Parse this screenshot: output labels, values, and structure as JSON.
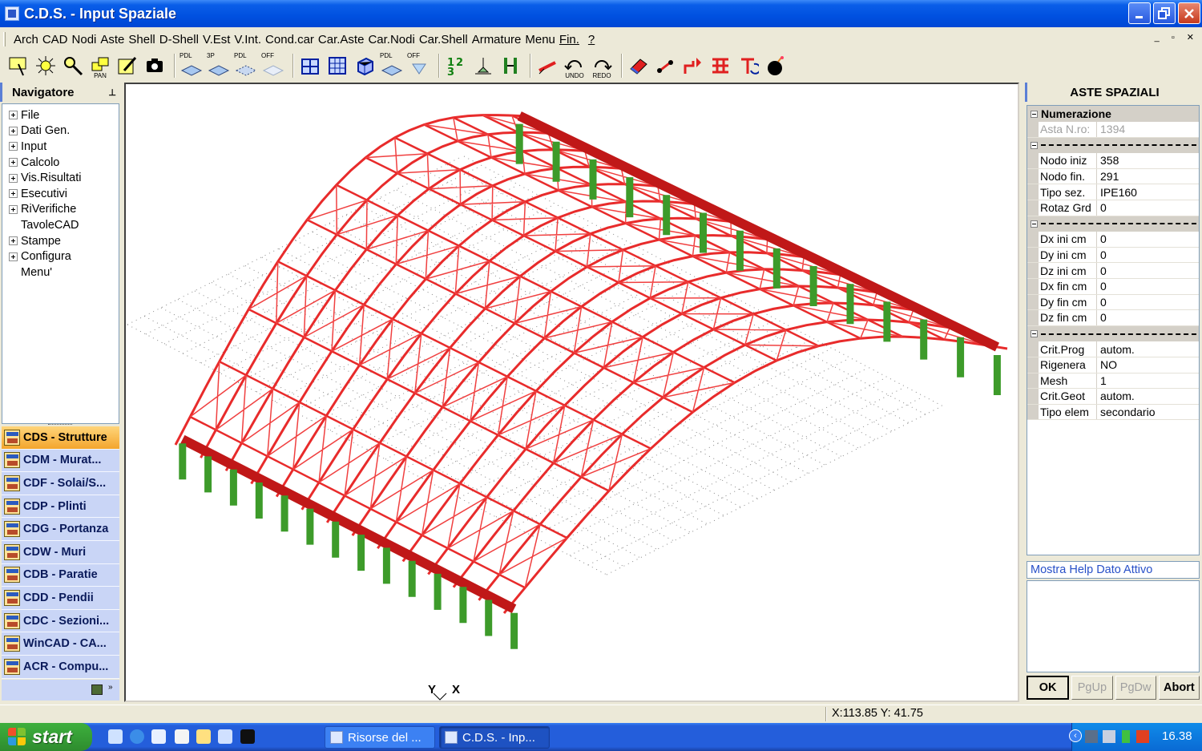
{
  "window": {
    "title": "C.D.S. - Input Spaziale"
  },
  "menu": {
    "items": [
      "Arch",
      "CAD",
      "Nodi",
      "Aste",
      "Shell",
      "D-Shell",
      "V.Est",
      "V.Int.",
      "Cond.car",
      "Car.Aste",
      "Car.Nodi",
      "Car.Shell",
      "Armature",
      "Menu",
      "Fin.",
      "?"
    ]
  },
  "toolbar": {
    "labels": {
      "pan": "PAN",
      "pdl1": "PDL",
      "p3": "3P",
      "pdl2": "PDL",
      "off1": "OFF",
      "pdl3": "PDL",
      "off2": "OFF",
      "undo": "UNDO",
      "redo": "REDO"
    }
  },
  "navigator": {
    "title": "Navigatore",
    "tree": [
      {
        "label": "File",
        "expandable": true
      },
      {
        "label": "Dati Gen.",
        "expandable": true
      },
      {
        "label": "Input",
        "expandable": true
      },
      {
        "label": "Calcolo",
        "expandable": true
      },
      {
        "label": "Vis.Risultati",
        "expandable": true
      },
      {
        "label": "Esecutivi",
        "expandable": true
      },
      {
        "label": "RiVerifiche",
        "expandable": true
      },
      {
        "label": "TavoleCAD",
        "expandable": false
      },
      {
        "label": "Stampe",
        "expandable": true
      },
      {
        "label": "Configura",
        "expandable": true
      },
      {
        "label": "Menu'",
        "expandable": false
      }
    ],
    "modules": [
      {
        "label": "CDS - Strutture",
        "active": true
      },
      {
        "label": "CDM - Murat...",
        "active": false
      },
      {
        "label": "CDF - Solai/S...",
        "active": false
      },
      {
        "label": "CDP - Plinti",
        "active": false
      },
      {
        "label": "CDG - Portanza",
        "active": false
      },
      {
        "label": "CDW - Muri",
        "active": false
      },
      {
        "label": "CDB - Paratie",
        "active": false
      },
      {
        "label": "CDD - Pendii",
        "active": false
      },
      {
        "label": "CDC - Sezioni...",
        "active": false
      },
      {
        "label": "WinCAD - CA...",
        "active": false
      },
      {
        "label": "ACR - Compu...",
        "active": false
      }
    ]
  },
  "viewport": {
    "axes_label": "YX"
  },
  "properties": {
    "title": "ASTE SPAZIALI",
    "category": "Numerazione",
    "readonly_row": {
      "key": "Asta N.ro:",
      "value": "1394"
    },
    "group1": [
      {
        "key": "Nodo iniz",
        "value": "358"
      },
      {
        "key": "Nodo fin.",
        "value": "291"
      },
      {
        "key": "Tipo sez.",
        "value": "IPE160"
      },
      {
        "key": "Rotaz Grd",
        "value": "0"
      }
    ],
    "group2": [
      {
        "key": "Dx ini cm",
        "value": "0"
      },
      {
        "key": "Dy ini cm",
        "value": "0"
      },
      {
        "key": "Dz ini cm",
        "value": "0"
      },
      {
        "key": "Dx fin cm",
        "value": "0"
      },
      {
        "key": "Dy fin cm",
        "value": "0"
      },
      {
        "key": "Dz fin cm",
        "value": "0"
      }
    ],
    "group3": [
      {
        "key": "Crit.Prog",
        "value": "autom."
      },
      {
        "key": "Rigenera",
        "value": "NO"
      },
      {
        "key": "Mesh",
        "value": "1"
      },
      {
        "key": "Crit.Geot",
        "value": "autom."
      },
      {
        "key": "Tipo elem",
        "value": "secondario"
      }
    ],
    "help_title": "Mostra Help Dato Attivo",
    "buttons": {
      "ok": "OK",
      "pgup": "PgUp",
      "pgdw": "PgDw",
      "abort": "Abort"
    }
  },
  "status": {
    "coords": "X:113.85  Y: 41.75"
  },
  "taskbar": {
    "start": "start",
    "tasks": [
      "Risorse del ...",
      "C.D.S. - Inp..."
    ],
    "clock": "16.38"
  },
  "colors": {
    "frame_red": "#e82b2b",
    "column_green": "#3d9b2a",
    "titlebar_blue": "#0050e0"
  }
}
